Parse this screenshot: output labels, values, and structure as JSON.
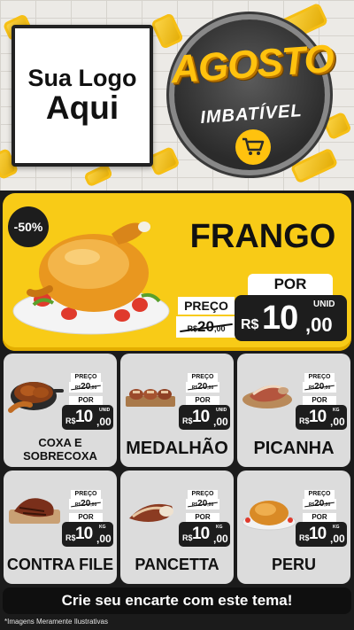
{
  "header": {
    "logo_line1": "Sua Logo",
    "logo_line2": "Aqui",
    "seal_title": "AGOSTO",
    "seal_subtitle": "IMBATÍVEL"
  },
  "featured": {
    "discount": "-50%",
    "name": "FRANGO",
    "por_label": "POR",
    "preco_label": "PREÇO",
    "old_currency": "R$",
    "old_price_int": "20",
    "old_price_dec": ",00",
    "currency": "R$",
    "price_int": "10",
    "price_dec": ",00",
    "unit": "UNID"
  },
  "products": [
    {
      "name_line1": "COXA E",
      "name_line2": "SOBRECOXA",
      "preco_label": "PREÇO",
      "old_currency": "R$",
      "old_price_int": "20",
      "old_price_dec": ",00",
      "por_label": "POR",
      "currency": "R$",
      "price_int": "10",
      "price_dec": ",00",
      "unit": "UNID"
    },
    {
      "name": "MEDALHÃO",
      "preco_label": "PREÇO",
      "old_currency": "R$",
      "old_price_int": "20",
      "old_price_dec": ",00",
      "por_label": "POR",
      "currency": "R$",
      "price_int": "10",
      "price_dec": ",00",
      "unit": "UNID"
    },
    {
      "name": "PICANHA",
      "preco_label": "PREÇO",
      "old_currency": "R$",
      "old_price_int": "20",
      "old_price_dec": ",00",
      "por_label": "POR",
      "currency": "R$",
      "price_int": "10",
      "price_dec": ",00",
      "unit": "KG"
    },
    {
      "name": "CONTRA FILE",
      "preco_label": "PREÇO",
      "old_currency": "R$",
      "old_price_int": "20",
      "old_price_dec": ",00",
      "por_label": "POR",
      "currency": "R$",
      "price_int": "10",
      "price_dec": ",00",
      "unit": "KG"
    },
    {
      "name": "PANCETTA",
      "preco_label": "PREÇO",
      "old_currency": "R$",
      "old_price_int": "20",
      "old_price_dec": ",00",
      "por_label": "POR",
      "currency": "R$",
      "price_int": "10",
      "price_dec": ",00",
      "unit": "KG"
    },
    {
      "name": "PERU",
      "preco_label": "PREÇO",
      "old_currency": "R$",
      "old_price_int": "20",
      "old_price_dec": ",00",
      "por_label": "POR",
      "currency": "R$",
      "price_int": "10",
      "price_dec": ",00",
      "unit": "KG"
    }
  ],
  "cta": "Crie seu encarte com este tema!",
  "disclaimer": "*Imagens Meramente Ilustrativas",
  "colors": {
    "accent_yellow": "#f8cb17",
    "dark": "#1d1d1d",
    "card_bg": "#dcdcdc"
  },
  "icons": [
    "shopping-cart-icon"
  ]
}
